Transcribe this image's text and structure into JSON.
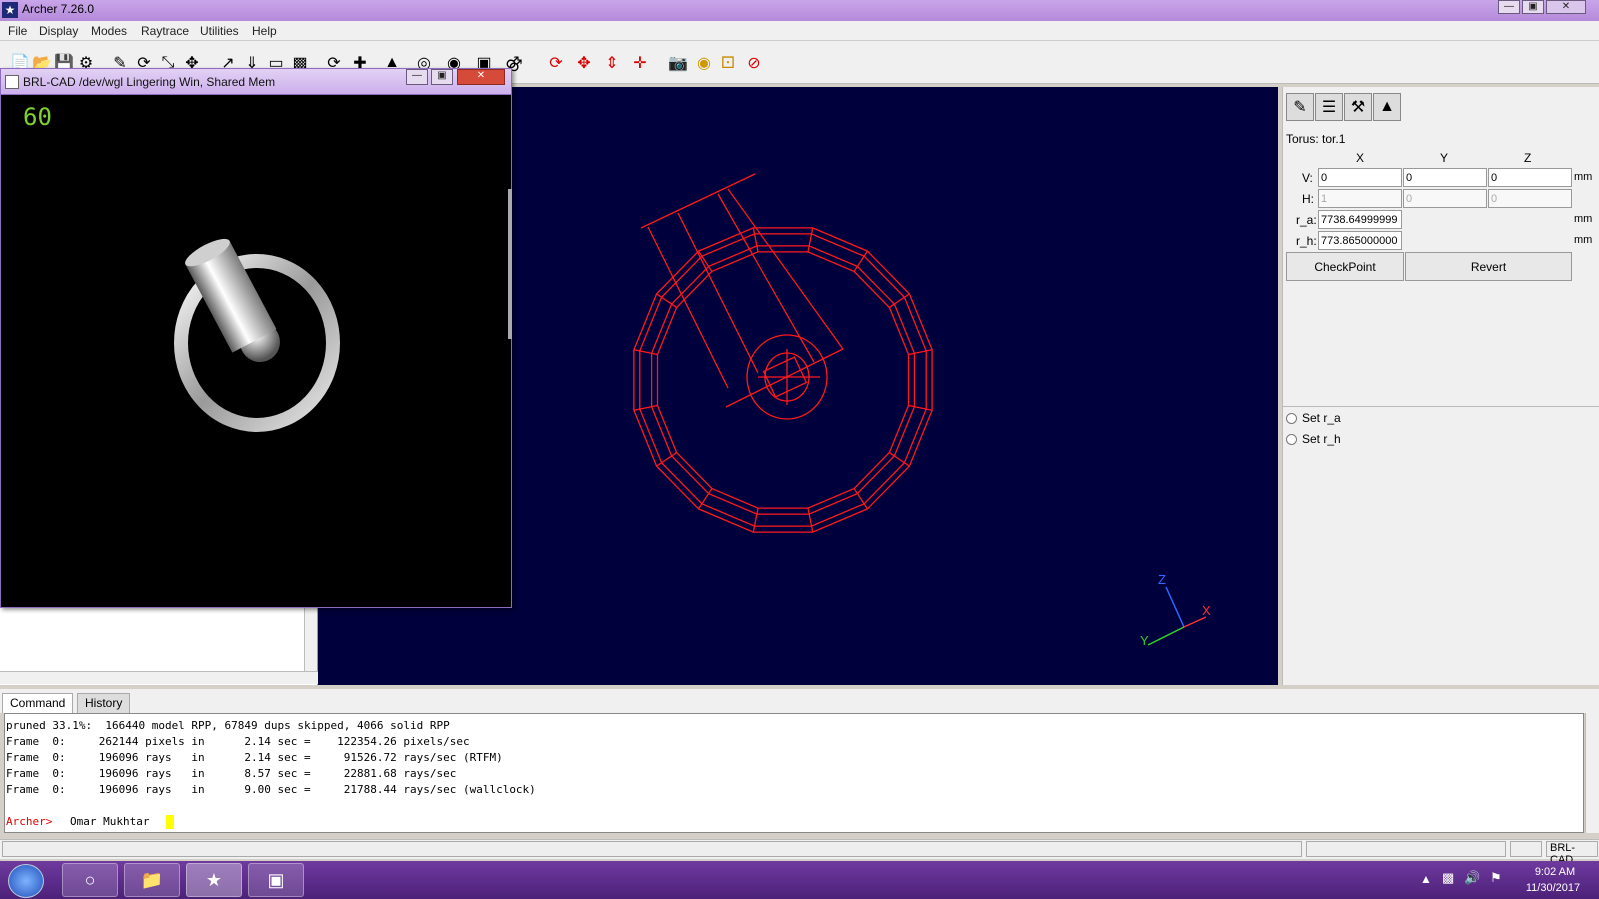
{
  "window": {
    "title": "Archer 7.26.0",
    "icon": "brlcad-figure-icon"
  },
  "menu": [
    "File",
    "Display",
    "Modes",
    "Raytrace",
    "Utilities",
    "Help"
  ],
  "toolbar": {
    "icons": [
      "new-file-icon",
      "open-folder-icon",
      "save-icon",
      "preferences-icon",
      "edit-icon",
      "rotate-icon",
      "scale-icon",
      "translate-icon",
      "component-select-icon",
      "center-view-icon",
      "rotate-view-icon",
      "translate-view-icon",
      "raytrace-icon",
      "measure-icon",
      "magnet-icon",
      "translate-arrows-icon",
      "rotate-arrow-icon",
      "scale-arrow-icon",
      "camera-icon",
      "nirt-icon",
      "clean-icon",
      "stop-raytrace-icon"
    ]
  },
  "raytrace_window": {
    "title": "BRL-CAD /dev/wgl Lingering Win, Shared Mem",
    "fps": "60"
  },
  "edit_panel": {
    "object_label": "Torus: tor.1",
    "col_x": "X",
    "col_y": "Y",
    "col_z": "Z",
    "v_label": "V:",
    "h_label": "H:",
    "ra_label": "r_a:",
    "rh_label": "r_h:",
    "v": [
      "0",
      "0",
      "0"
    ],
    "h": [
      "1",
      "0",
      "0"
    ],
    "r_a": "7738.64999999",
    "r_h": "773.865000000",
    "unit": "mm",
    "checkpoint": "CheckPoint",
    "revert": "Revert",
    "radio_set_ra": "Set r_a",
    "radio_set_rh": "Set r_h"
  },
  "tabs": {
    "command": "Command",
    "history": "History"
  },
  "console": {
    "lines": [
      "pruned 33.1%:  166440 model RPP, 67849 dups skipped, 4066 solid RPP",
      "Frame  0:     262144 pixels in      2.14 sec =    122354.26 pixels/sec",
      "Frame  0:     196096 rays   in      2.14 sec =     91526.72 rays/sec (RTFM)",
      "Frame  0:     196096 rays   in      8.57 sec =     22881.68 rays/sec",
      "Frame  0:     196096 rays   in      9.00 sec =     21788.44 rays/sec (wallclock)"
    ],
    "prompt": "Archer>",
    "input": "Omar Mukhtar"
  },
  "statusbar": {
    "app": "BRL-CAD"
  },
  "taskbar": {
    "time": "9:02 AM",
    "date": "11/30/2017"
  },
  "axes": {
    "x": "X",
    "y": "Y",
    "z": "Z"
  },
  "colors": {
    "wireframe": "#ff1a1a",
    "viewport_bg": "#00003c",
    "prompt": "#e00000",
    "cursor": "#ffff00",
    "fps": "#7fd130"
  }
}
